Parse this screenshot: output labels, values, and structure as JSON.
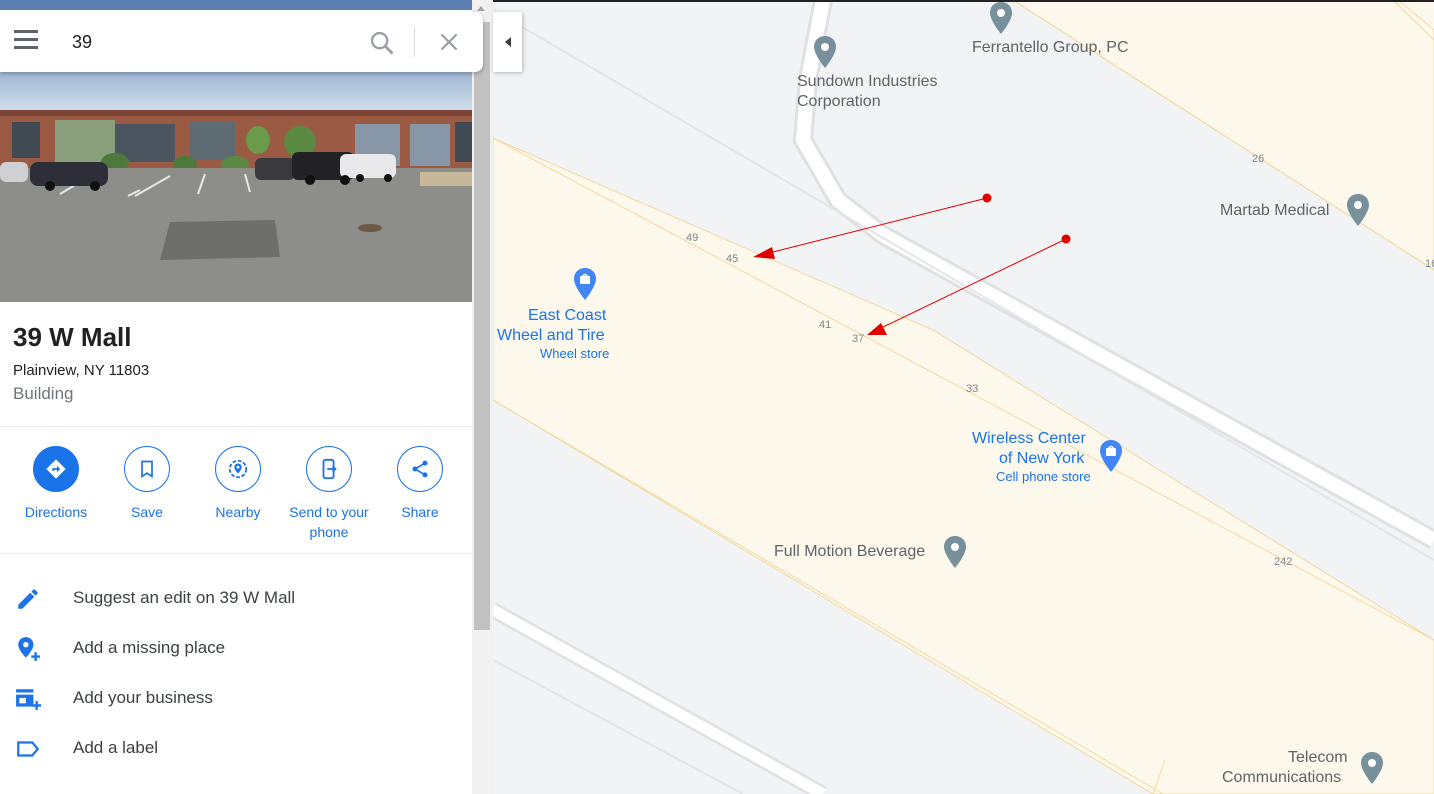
{
  "search": {
    "value": "39",
    "placeholder": "Search Google Maps"
  },
  "place": {
    "title": "39 W Mall",
    "address": "Plainview, NY 11803",
    "type": "Building"
  },
  "actions": [
    {
      "label": "Directions",
      "icon": "directions-icon"
    },
    {
      "label": "Save",
      "icon": "bookmark-icon"
    },
    {
      "label": "Nearby",
      "icon": "nearby-icon"
    },
    {
      "label": "Send to your phone",
      "icon": "send-to-phone-icon"
    },
    {
      "label": "Share",
      "icon": "share-icon"
    }
  ],
  "menu": [
    {
      "label": "Suggest an edit on 39 W Mall",
      "icon": "pencil-icon"
    },
    {
      "label": "Add a missing place",
      "icon": "add-place-icon"
    },
    {
      "label": "Add your business",
      "icon": "add-business-icon"
    },
    {
      "label": "Add a label",
      "icon": "label-icon"
    }
  ],
  "map": {
    "pois": {
      "ferrantello": "Ferrantello Group, PC",
      "sundown_1": "Sundown Industries",
      "sundown_2": "Corporation",
      "martab": "Martab Medical",
      "eastcoast_1": "East Coast",
      "eastcoast_2": "Wheel and Tire",
      "eastcoast_sub": "Wheel store",
      "wireless_1": "Wireless Center",
      "wireless_2": "of New York",
      "wireless_sub": "Cell phone store",
      "fullmotion": "Full Motion Beverage",
      "telecom_1": "Telecom",
      "telecom_2": "Communications"
    },
    "street_numbers": {
      "n49": "49",
      "n45": "45",
      "n41": "41",
      "n37": "37",
      "n33": "33",
      "n26": "26",
      "n242": "242",
      "n16": "16"
    }
  },
  "colors": {
    "accent": "#1a73e8",
    "poi_grey": "#5f6368",
    "building_fill": "#fdf8ec",
    "annotation_red": "#e00000"
  }
}
